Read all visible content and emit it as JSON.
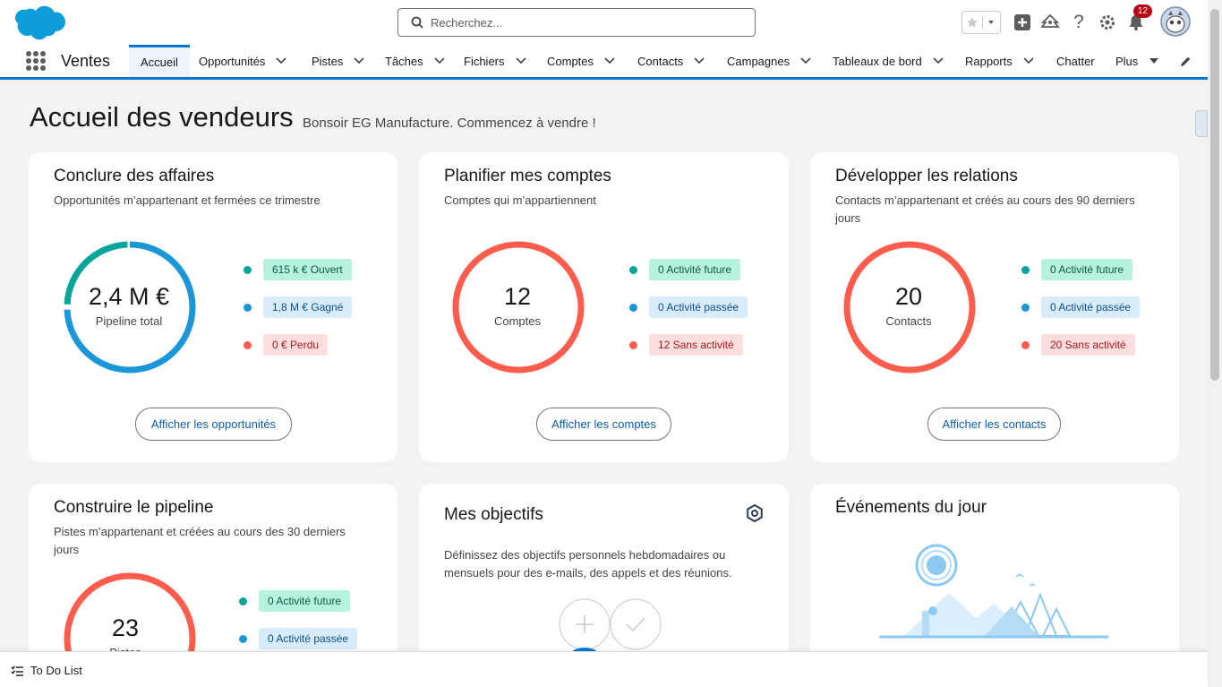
{
  "header": {
    "search_placeholder": "Recherchez...",
    "notification_count": "12"
  },
  "nav": {
    "app_name": "Ventes",
    "items": [
      {
        "label": "Accueil"
      },
      {
        "label": "Opportunités"
      },
      {
        "label": "Pistes"
      },
      {
        "label": "Tâches"
      },
      {
        "label": "Fichiers"
      },
      {
        "label": "Comptes"
      },
      {
        "label": "Contacts"
      },
      {
        "label": "Campagnes"
      },
      {
        "label": "Tableaux de bord"
      },
      {
        "label": "Rapports"
      },
      {
        "label": "Chatter"
      },
      {
        "label": "Plus"
      }
    ]
  },
  "page": {
    "title": "Accueil des vendeurs",
    "subtitle": "Bonsoir EG Manufacture. Commencez à vendre !"
  },
  "cards": {
    "deals": {
      "title": "Conclure des affaires",
      "subtitle": "Opportunités m’appartenant et fermées ce trimestre",
      "value": "2,4 M €",
      "value_label": "Pipeline total",
      "legend": [
        "615 k € Ouvert",
        "1,8 M € Gagné",
        "0 € Perdu"
      ],
      "button": "Afficher les opportunités",
      "ring_fraction_open": 0.25
    },
    "accounts": {
      "title": "Planifier mes comptes",
      "subtitle": "Comptes qui m’appartiennent",
      "value": "12",
      "value_label": "Comptes",
      "legend": [
        "0 Activité future",
        "0 Activité passée",
        "12 Sans activité"
      ],
      "button": "Afficher les comptes"
    },
    "relations": {
      "title": "Développer les relations",
      "subtitle": "Contacts m’appartenant et créés au cours des 90 derniers jours",
      "value": "20",
      "value_label": "Contacts",
      "legend": [
        "0 Activité future",
        "0 Activité passée",
        "20 Sans activité"
      ],
      "button": "Afficher les contacts"
    },
    "pipeline": {
      "title": "Construire le pipeline",
      "subtitle": "Pistes m’appartenant et créées au cours des 30 derniers jours",
      "value": "23",
      "value_label": "Pistes",
      "legend": [
        "0 Activité future",
        "0 Activité passée"
      ]
    },
    "goals": {
      "title": "Mes objectifs",
      "description": "Définissez des objectifs personnels hebdomadaires ou mensuels pour des e-mails, des appels et des réunions."
    },
    "events": {
      "title": "Événements du jour"
    }
  },
  "dock": {
    "todo_label": "To Do List"
  },
  "colors": {
    "brand": "#0176d3",
    "ring_blue": "#1b96d8",
    "ring_teal": "#06a59a",
    "ring_red": "#fe5c4c"
  }
}
